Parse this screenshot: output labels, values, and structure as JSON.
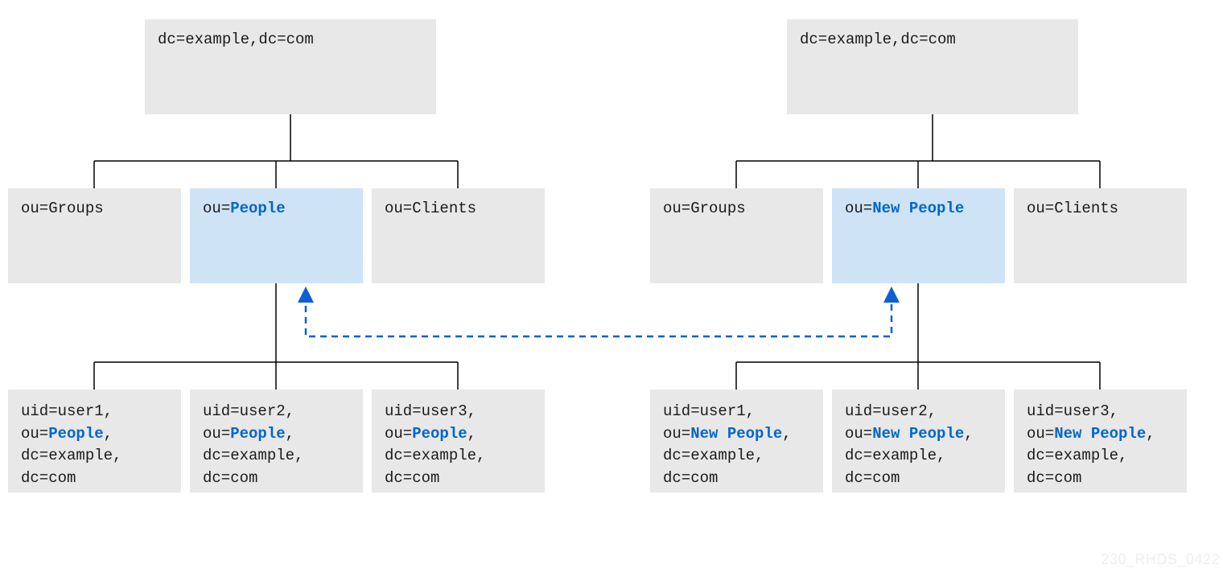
{
  "colors": {
    "node_bg": "#e8e8e8",
    "highlight_bg": "#cfe3f7",
    "accent_blue": "#0066cc",
    "line": "#000000",
    "dash": "#0d5fd4"
  },
  "left_tree": {
    "root": "dc=example,dc=com",
    "ous": {
      "groups": {
        "prefix": "ou=",
        "value": "Groups"
      },
      "people": {
        "prefix": "ou=",
        "value": "People"
      },
      "clients": {
        "prefix": "ou=",
        "value": "Clients"
      }
    },
    "leaves": [
      {
        "uid": "uid=user1,",
        "ou_prefix": "ou=",
        "ou_value": "People",
        "ou_suffix": ",",
        "dc1": "dc=example,",
        "dc2": "dc=com"
      },
      {
        "uid": "uid=user2,",
        "ou_prefix": "ou=",
        "ou_value": "People",
        "ou_suffix": ",",
        "dc1": "dc=example,",
        "dc2": "dc=com"
      },
      {
        "uid": "uid=user3,",
        "ou_prefix": "ou=",
        "ou_value": "People",
        "ou_suffix": ",",
        "dc1": "dc=example,",
        "dc2": "dc=com"
      }
    ]
  },
  "right_tree": {
    "root": "dc=example,dc=com",
    "ous": {
      "groups": {
        "prefix": "ou=",
        "value": "Groups"
      },
      "people": {
        "prefix": "ou=",
        "value": "New People"
      },
      "clients": {
        "prefix": "ou=",
        "value": "Clients"
      }
    },
    "leaves": [
      {
        "uid": "uid=user1,",
        "ou_prefix": "ou=",
        "ou_value": "New People",
        "ou_suffix": ",",
        "dc1": "dc=example,",
        "dc2": "dc=com"
      },
      {
        "uid": "uid=user2,",
        "ou_prefix": "ou=",
        "ou_value": "New People",
        "ou_suffix": ",",
        "dc1": "dc=example,",
        "dc2": "dc=com"
      },
      {
        "uid": "uid=user3,",
        "ou_prefix": "ou=",
        "ou_value": "New People",
        "ou_suffix": ",",
        "dc1": "dc=example,",
        "dc2": "dc=com"
      }
    ]
  },
  "watermark": "230_RHDS_0422"
}
